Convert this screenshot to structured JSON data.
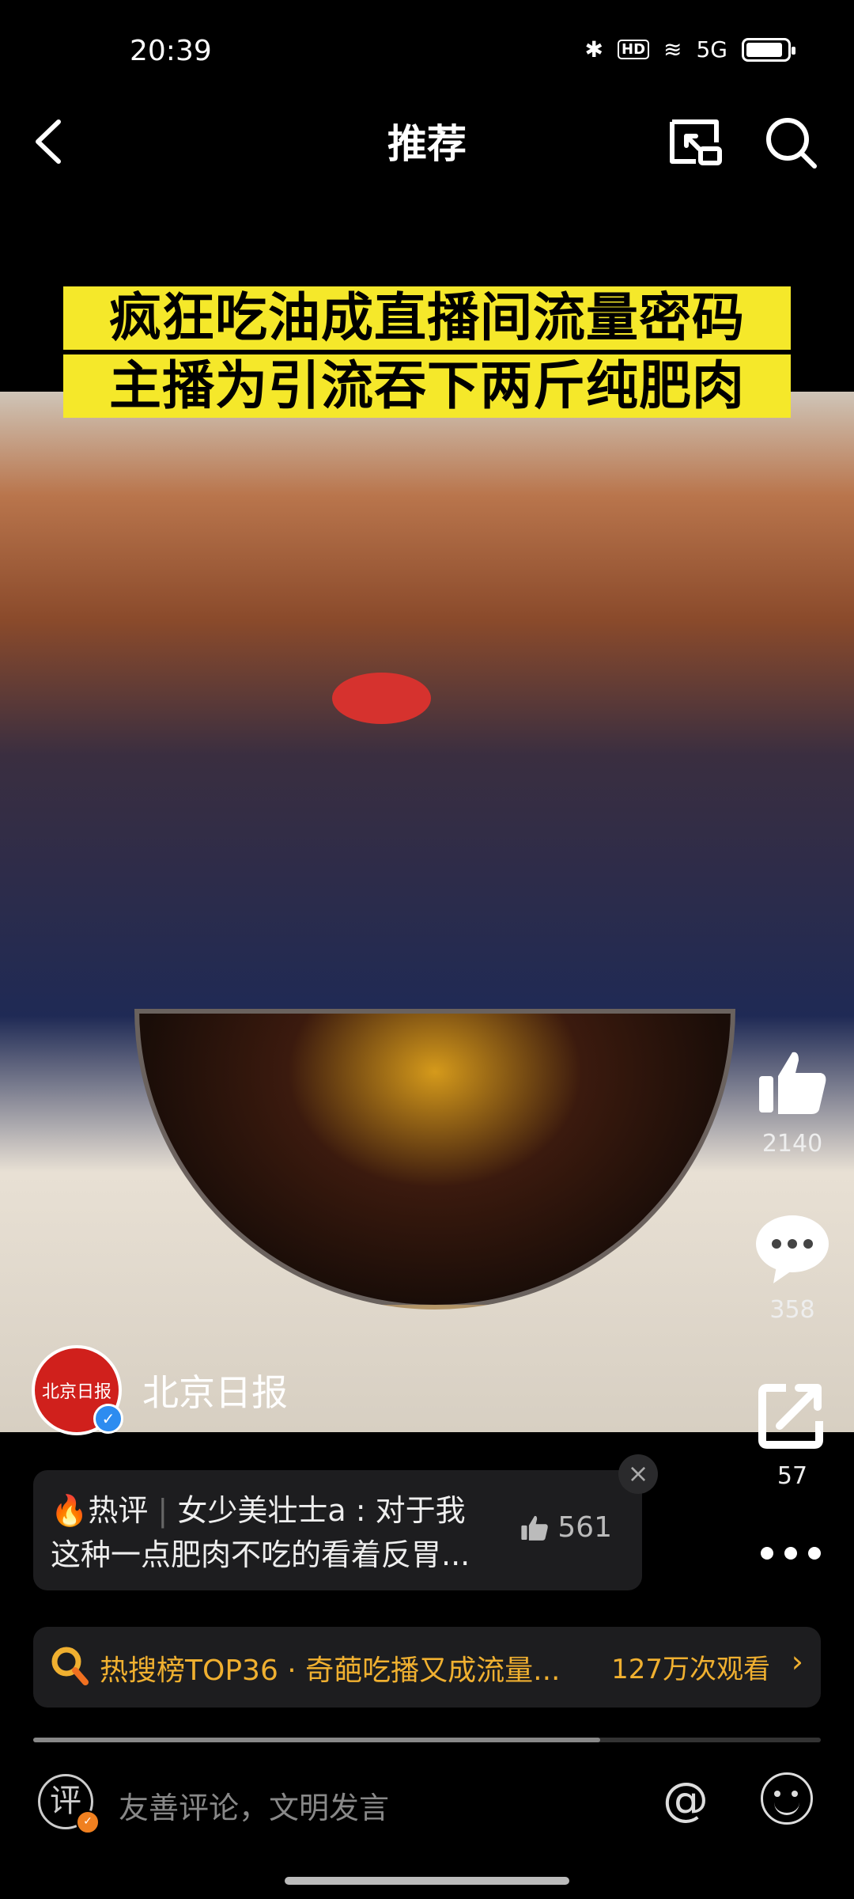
{
  "status": {
    "time": "20:39",
    "bluetooth": "✱",
    "hd": "HD",
    "wifi": "≋",
    "signal": "5G"
  },
  "header": {
    "title": "推荐"
  },
  "video": {
    "caption_line1": "疯狂吃油成直播间流量密码",
    "caption_line2": "主播为引流吞下两斤纯肥肉"
  },
  "actions": {
    "likes": "2140",
    "comments": "358",
    "shares": "57"
  },
  "account": {
    "name": "北京日报",
    "avatar_text": "北京日报"
  },
  "hot_comment": {
    "tag": "热评",
    "user": "女少美壮士a",
    "line1_text": "对于我",
    "line2": "这种一点肥肉不吃的看着反胃...",
    "likes": "561"
  },
  "hot_search": {
    "text": "热搜榜TOP36 · 奇葩吃播又成流量...",
    "views": "127万次观看"
  },
  "progress": 0.72,
  "input": {
    "placeholder": "友善评论，文明发言",
    "comment_badge": "评"
  },
  "colors": {
    "caption_bg": "#f5e82a",
    "hot_search": "#f0b030",
    "verified": "#2d8cf0"
  }
}
